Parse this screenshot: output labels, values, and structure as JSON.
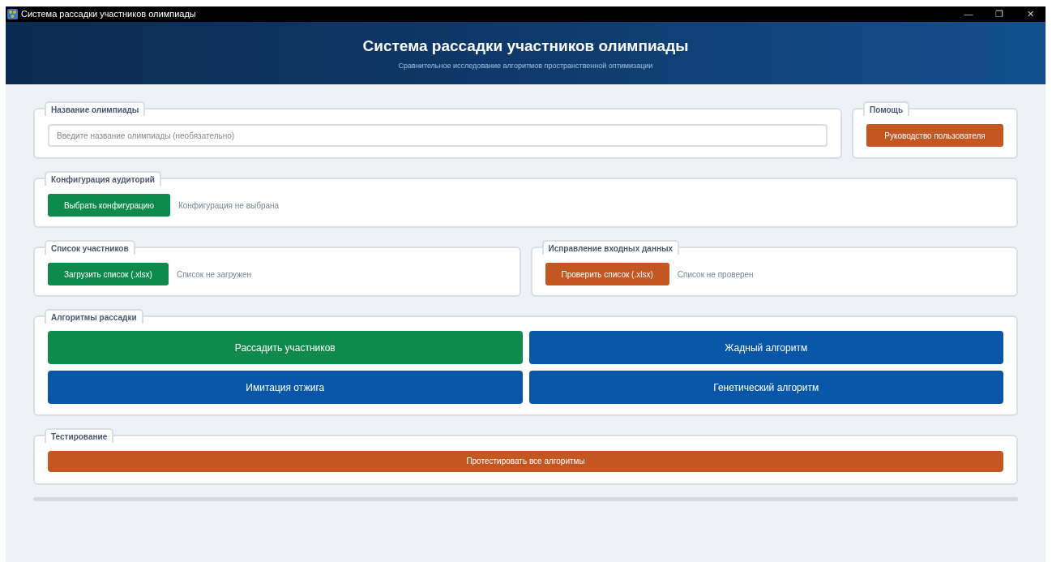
{
  "window": {
    "title": "Система рассадки участников олимпиады",
    "controls": [
      "—",
      "❐",
      "✕"
    ]
  },
  "header": {
    "title": "Система рассадки участников олимпиады",
    "subtitle": "Сравнительное исследование алгоритмов пространственной оптимизации"
  },
  "olympiad_name": {
    "legend": "Название олимпиады",
    "placeholder": "Введите название олимпиады (необязательно)"
  },
  "help": {
    "legend": "Помощь",
    "button": "Руководство пользователя"
  },
  "rooms": {
    "legend": "Конфигурация аудиторий",
    "button": "Выбрать конфигурацию",
    "status": "Конфигурация не выбрана"
  },
  "participants": {
    "legend": "Список участников",
    "button": "Загрузить список (.xlsx)",
    "status": "Список не загружен"
  },
  "input_fix": {
    "legend": "Исправление входных данных",
    "button": "Проверить список (.xlsx)",
    "status": "Список не проверен"
  },
  "algorithms": {
    "legend": "Алгоритмы рассадки",
    "buttons": [
      {
        "label": "Рассадить участников",
        "kind": "primary"
      },
      {
        "label": "Жадный алгоритм",
        "kind": "algorithm"
      },
      {
        "label": "Имитация отжига",
        "kind": "algorithm"
      },
      {
        "label": "Генетический алгоритм",
        "kind": "algorithm"
      }
    ]
  },
  "testing": {
    "legend": "Тестирование",
    "button": "Протестировать все алгоритмы"
  },
  "progress": {
    "level": 0
  }
}
